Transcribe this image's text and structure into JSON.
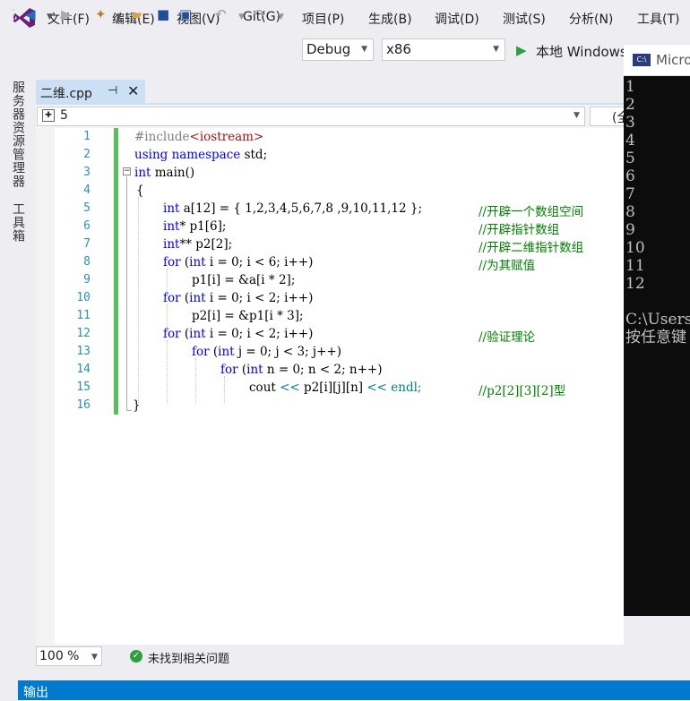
{
  "menu": [
    "文件(F)",
    "编辑(E)",
    "视图(V)",
    "Git(G)",
    "项目(P)",
    "生成(B)",
    "调试(D)",
    "测试(S)",
    "分析(N)",
    "工具(T)"
  ],
  "toolbar": {
    "config": "Debug",
    "platform": "x86",
    "run_label": "本地 Windows"
  },
  "sidebar": {
    "tab1": "服务器资源管理器",
    "tab2": "工具箱"
  },
  "editor": {
    "tab_name": "二维.cpp",
    "nav_value": "5",
    "nav_scope": "(全",
    "lines": [
      "1",
      "2",
      "3",
      "4",
      "5",
      "6",
      "7",
      "8",
      "9",
      "10",
      "11",
      "12",
      "13",
      "14",
      "15",
      "16"
    ],
    "code": {
      "l1_pp": "#include",
      "l1_str": "<iostream>",
      "l2_kw": "using namespace",
      "l2_rest": " std;",
      "l3_kw": "int",
      "l3_rest": " main()",
      "l4": "{",
      "l5_kw": "int",
      "l5_rest": " a[12] = { 1,2,3,4,5,6,7,8 ,9,10,11,12 };",
      "l5_cm": "//开辟一个数组空间",
      "l6_kw": "int",
      "l6_rest": "* p1[6];",
      "l6_cm": "//开辟指针数组",
      "l7_kw": "int",
      "l7_rest": "** p2[2];",
      "l7_cm": "//开辟二维指针数组",
      "l8_kw1": "for",
      "l8_p1": " (",
      "l8_kw2": "int",
      "l8_rest": " i = 0; i < 6; i++)",
      "l8_cm": "//为其赋值",
      "l9": "p1[i] = &a[i * 2];",
      "l10_kw1": "for",
      "l10_p1": " (",
      "l10_kw2": "int",
      "l10_rest": " i = 0; i < 2; i++)",
      "l11": "p2[i] = &p1[i * 3];",
      "l12_kw1": "for",
      "l12_p1": " (",
      "l12_kw2": "int",
      "l12_rest": " i = 0; i < 2; i++)",
      "l12_cm": "//验证理论",
      "l13_kw1": "for",
      "l13_p1": " (",
      "l13_kw2": "int",
      "l13_rest": " j = 0; j < 3; j++)",
      "l14_kw1": "for",
      "l14_p1": " (",
      "l14_kw2": "int",
      "l14_rest": " n = 0; n < 2; n++)",
      "l15_a": "cout ",
      "l15_op1": "<<",
      "l15_b": " p2[i][j][n] ",
      "l15_op2": "<<",
      "l15_c": " endl;",
      "l15_cm": "//p2[2][3][2]型",
      "l16": "}"
    }
  },
  "status": {
    "zoom": "100 %",
    "issues": "未找到相关问题"
  },
  "output": {
    "label": "输出"
  },
  "console": {
    "title": "Micro",
    "lines": [
      "1",
      "2",
      "3",
      "4",
      "5",
      "6",
      "7",
      "8",
      "9",
      "10",
      "11",
      "12"
    ],
    "path": "C:\\Users",
    "prompt": "按任意键"
  },
  "colors": {
    "accent": "#007acc",
    "keyword": "#0000ff",
    "comment": "#008000",
    "line_number": "#2b91af",
    "change_bar": "#57c058"
  }
}
